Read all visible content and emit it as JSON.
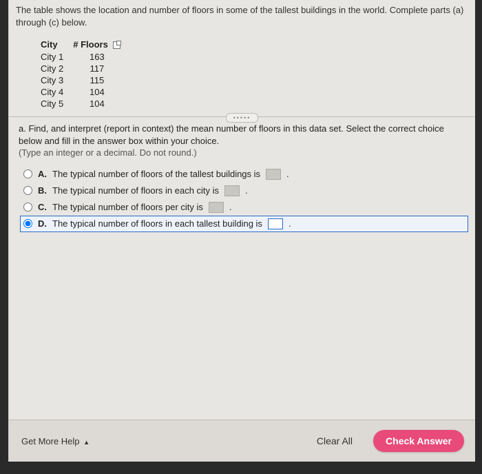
{
  "intro": "The table shows the location and number of floors in some of the tallest buildings in the world. Complete parts (a) through (c) below.",
  "table": {
    "headers": {
      "city": "City",
      "floors": "# Floors"
    },
    "rows": [
      {
        "city": "City 1",
        "floors": "163"
      },
      {
        "city": "City 2",
        "floors": "117"
      },
      {
        "city": "City 3",
        "floors": "115"
      },
      {
        "city": "City 4",
        "floors": "104"
      },
      {
        "city": "City 5",
        "floors": "104"
      }
    ]
  },
  "partA": {
    "prompt": "a. Find, and interpret (report in context) the mean number of floors in this data set. Select the correct choice below and fill in the answer box within your choice.",
    "hint": "(Type an integer or a decimal. Do not round.)",
    "options": {
      "A": {
        "label": "A.",
        "text": "The typical number of floors of the tallest buildings is",
        "suffix": "."
      },
      "B": {
        "label": "B.",
        "text": "The typical number of floors in each city is",
        "suffix": "."
      },
      "C": {
        "label": "C.",
        "text": "The typical number of floors per city is",
        "suffix": "."
      },
      "D": {
        "label": "D.",
        "text": "The typical number of floors in each tallest building is",
        "suffix": "."
      }
    }
  },
  "footer": {
    "getHelp": "Get More Help",
    "clearAll": "Clear All",
    "checkAnswer": "Check Answer"
  }
}
